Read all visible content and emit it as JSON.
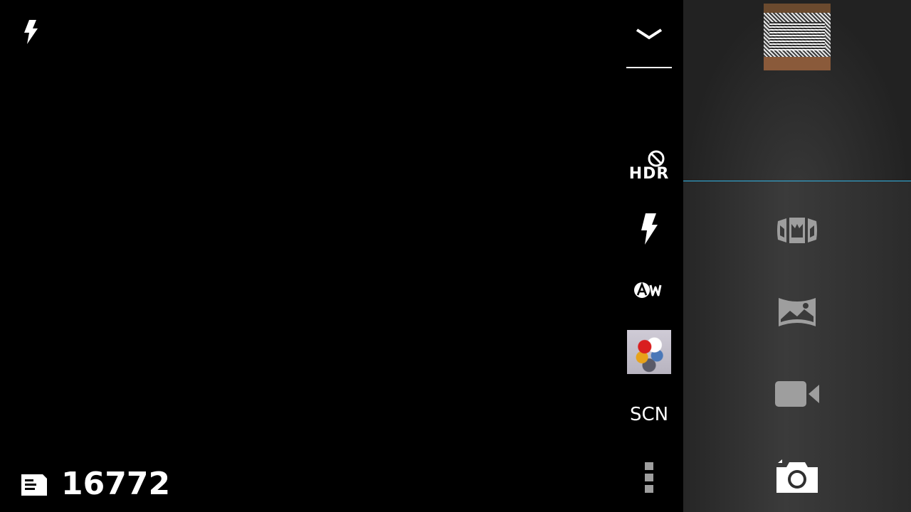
{
  "status": {
    "flash_icon": "flash-on-icon",
    "storage_icon": "sd-card-icon",
    "remaining_shots": "16772"
  },
  "settings": {
    "collapse_icon": "chevron-down-icon",
    "hdr_label": "HDR",
    "hdr_state_icon": "disabled-icon",
    "flash_icon": "flash-icon",
    "white_balance_icon": "auto-white-balance-icon",
    "effect_icon": "color-effect-thumbnail",
    "scene_label": "SCN",
    "more_icon": "more-options-icon"
  },
  "modes": {
    "gallery_icon": "last-photo-thumbnail",
    "items": [
      {
        "icon": "photo-sphere-icon"
      },
      {
        "icon": "panorama-icon"
      },
      {
        "icon": "video-camera-icon"
      },
      {
        "icon": "camera-icon"
      }
    ]
  },
  "colors": {
    "accent": "#33b5e5",
    "icon_active": "#ffffff",
    "icon_inactive": "#9e9e9e"
  }
}
